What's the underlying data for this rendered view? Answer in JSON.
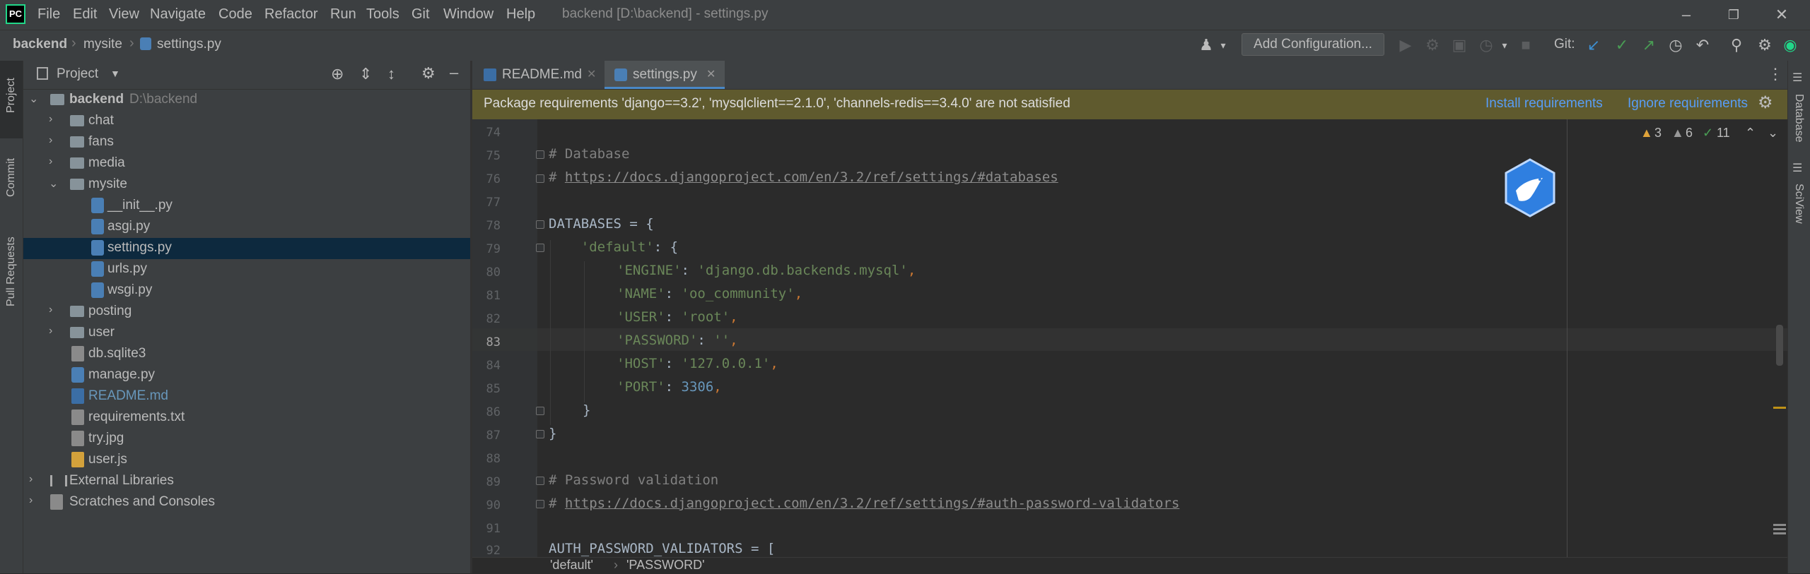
{
  "menu": [
    "File",
    "Edit",
    "View",
    "Navigate",
    "Code",
    "Refactor",
    "Run",
    "Tools",
    "Git",
    "Window",
    "Help"
  ],
  "window_title": "backend [D:\\backend] - settings.py",
  "breadcrumb": [
    "backend",
    "mysite",
    "settings.py"
  ],
  "toolbar": {
    "add_configuration": "Add Configuration...",
    "git_label": "Git:"
  },
  "left_tabs": [
    "Project",
    "Commit",
    "Pull Requests"
  ],
  "right_tabs": [
    "Database",
    "SciView"
  ],
  "project": {
    "title": "Project",
    "tree": [
      {
        "label": "backend",
        "extra": "D:\\backend"
      },
      {
        "label": "chat"
      },
      {
        "label": "fans"
      },
      {
        "label": "media"
      },
      {
        "label": "mysite"
      },
      {
        "label": "__init__.py"
      },
      {
        "label": "asgi.py"
      },
      {
        "label": "settings.py"
      },
      {
        "label": "urls.py"
      },
      {
        "label": "wsgi.py"
      },
      {
        "label": "posting"
      },
      {
        "label": "user"
      },
      {
        "label": "db.sqlite3"
      },
      {
        "label": "manage.py"
      },
      {
        "label": "README.md"
      },
      {
        "label": "requirements.txt"
      },
      {
        "label": "try.jpg"
      },
      {
        "label": "user.js"
      },
      {
        "label": "External Libraries"
      },
      {
        "label": "Scratches and Consoles"
      }
    ]
  },
  "tabs": [
    {
      "label": "README.md"
    },
    {
      "label": "settings.py"
    }
  ],
  "banner": {
    "text": "Package requirements 'django==3.2', 'mysqlclient==2.1.0', 'channels-redis==3.4.0' are not satisfied",
    "install": "Install requirements",
    "ignore": "Ignore requirements"
  },
  "inspections": {
    "warnings": "3",
    "weak": "6",
    "ok": "11"
  },
  "line_numbers": [
    "74",
    "75",
    "76",
    "77",
    "78",
    "79",
    "80",
    "81",
    "82",
    "83",
    "84",
    "85",
    "86",
    "87",
    "88",
    "89",
    "90",
    "91",
    "92"
  ],
  "code": {
    "l75": "# Database",
    "l76a": "# ",
    "l76b": "https://docs.djangoproject.com/en/3.2/ref/settings/#databases",
    "l78": "DATABASES = {",
    "l79a": "    ",
    "l79b": "'default'",
    "l79c": ": {",
    "l80a": "'ENGINE'",
    "l80b": ": ",
    "l80c": "'django.db.backends.mysql'",
    "l80d": ",",
    "l81a": "'NAME'",
    "l81b": ": ",
    "l81c": "'oo_community'",
    "l81d": ",",
    "l82a": "'USER'",
    "l82b": ": ",
    "l82c": "'root'",
    "l82d": ",",
    "l83a": "'PASSWORD'",
    "l83b": ": ",
    "l83c": "''",
    "l83d": ",",
    "l84a": "'HOST'",
    "l84b": ": ",
    "l84c": "'127.0.0.1'",
    "l84d": ",",
    "l85a": "'PORT'",
    "l85b": ": ",
    "l85c": "3306",
    "l85d": ",",
    "l86": "}",
    "l87": "}",
    "l89": "# Password validation",
    "l90a": "# ",
    "l90b": "https://docs.djangoproject.com/en/3.2/ref/settings/#auth-password-validators",
    "l92": "AUTH_PASSWORD_VALIDATORS = ["
  },
  "bottom_breadcrumb": [
    "'default'",
    "'PASSWORD'"
  ],
  "colors": {
    "banner": "#5f5a2e",
    "selection": "#0d293e",
    "link": "#589df6",
    "string": "#6a8759",
    "number": "#6897bb"
  }
}
